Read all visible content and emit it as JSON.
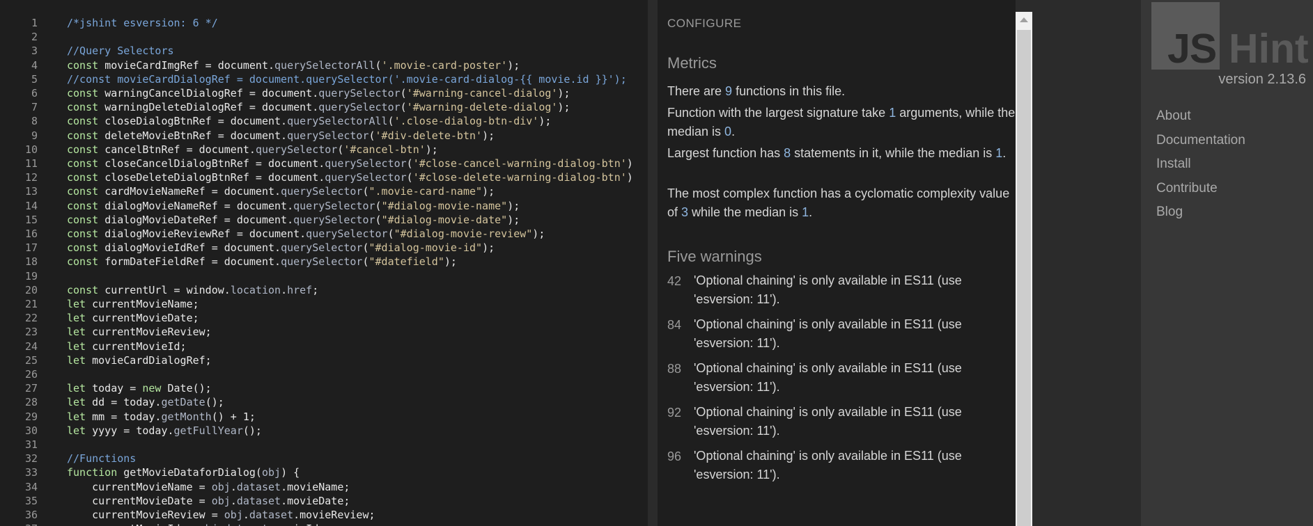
{
  "editor": {
    "lines": [
      {
        "n": "1",
        "t": [
          {
            "c": "cm",
            "s": "/*jshint esversion: 6 */"
          }
        ]
      },
      {
        "n": "2",
        "t": []
      },
      {
        "n": "3",
        "t": [
          {
            "c": "cm",
            "s": "//Query Selectors"
          }
        ]
      },
      {
        "n": "4",
        "t": [
          {
            "c": "kw",
            "s": "const "
          },
          {
            "c": "tx",
            "s": "movieCardImgRef = document."
          },
          {
            "c": "fn",
            "s": "querySelectorAll"
          },
          {
            "c": "tx",
            "s": "("
          },
          {
            "c": "st",
            "s": "'.movie-card-poster'"
          },
          {
            "c": "tx",
            "s": ");"
          }
        ]
      },
      {
        "n": "5",
        "t": [
          {
            "c": "cm",
            "s": "//const movieCardDialogRef = document.querySelector('.movie-card-dialog-{{ movie.id }}');"
          }
        ]
      },
      {
        "n": "6",
        "t": [
          {
            "c": "kw",
            "s": "const "
          },
          {
            "c": "tx",
            "s": "warningCancelDialogRef = document."
          },
          {
            "c": "fn",
            "s": "querySelector"
          },
          {
            "c": "tx",
            "s": "("
          },
          {
            "c": "st",
            "s": "'#warning-cancel-dialog'"
          },
          {
            "c": "tx",
            "s": ");"
          }
        ]
      },
      {
        "n": "7",
        "t": [
          {
            "c": "kw",
            "s": "const "
          },
          {
            "c": "tx",
            "s": "warningDeleteDialogRef = document."
          },
          {
            "c": "fn",
            "s": "querySelector"
          },
          {
            "c": "tx",
            "s": "("
          },
          {
            "c": "st",
            "s": "'#warning-delete-dialog'"
          },
          {
            "c": "tx",
            "s": ");"
          }
        ]
      },
      {
        "n": "8",
        "t": [
          {
            "c": "kw",
            "s": "const "
          },
          {
            "c": "tx",
            "s": "closeDialogBtnRef = document."
          },
          {
            "c": "fn",
            "s": "querySelectorAll"
          },
          {
            "c": "tx",
            "s": "("
          },
          {
            "c": "st",
            "s": "'.close-dialog-btn-div'"
          },
          {
            "c": "tx",
            "s": ");"
          }
        ]
      },
      {
        "n": "9",
        "t": [
          {
            "c": "kw",
            "s": "const "
          },
          {
            "c": "tx",
            "s": "deleteMovieBtnRef = document."
          },
          {
            "c": "fn",
            "s": "querySelector"
          },
          {
            "c": "tx",
            "s": "("
          },
          {
            "c": "st",
            "s": "'#div-delete-btn'"
          },
          {
            "c": "tx",
            "s": ");"
          }
        ]
      },
      {
        "n": "10",
        "t": [
          {
            "c": "kw",
            "s": "const "
          },
          {
            "c": "tx",
            "s": "cancelBtnRef = document."
          },
          {
            "c": "fn",
            "s": "querySelector"
          },
          {
            "c": "tx",
            "s": "("
          },
          {
            "c": "st",
            "s": "'#cancel-btn'"
          },
          {
            "c": "tx",
            "s": ");"
          }
        ]
      },
      {
        "n": "11",
        "t": [
          {
            "c": "kw",
            "s": "const "
          },
          {
            "c": "tx",
            "s": "closeCancelDialogBtnRef = document."
          },
          {
            "c": "fn",
            "s": "querySelector"
          },
          {
            "c": "tx",
            "s": "("
          },
          {
            "c": "st",
            "s": "'#close-cancel-warning-dialog-btn'"
          },
          {
            "c": "tx",
            "s": ")"
          }
        ]
      },
      {
        "n": "12",
        "t": [
          {
            "c": "kw",
            "s": "const "
          },
          {
            "c": "tx",
            "s": "closeDeleteDialogBtnRef = document."
          },
          {
            "c": "fn",
            "s": "querySelector"
          },
          {
            "c": "tx",
            "s": "("
          },
          {
            "c": "st",
            "s": "'#close-delete-warning-dialog-btn'"
          },
          {
            "c": "tx",
            "s": ")"
          }
        ]
      },
      {
        "n": "13",
        "t": [
          {
            "c": "kw",
            "s": "const "
          },
          {
            "c": "tx",
            "s": "cardMovieNameRef = document."
          },
          {
            "c": "fn",
            "s": "querySelector"
          },
          {
            "c": "tx",
            "s": "("
          },
          {
            "c": "st",
            "s": "\".movie-card-name\""
          },
          {
            "c": "tx",
            "s": ");"
          }
        ]
      },
      {
        "n": "14",
        "t": [
          {
            "c": "kw",
            "s": "const "
          },
          {
            "c": "tx",
            "s": "dialogMovieNameRef = document."
          },
          {
            "c": "fn",
            "s": "querySelector"
          },
          {
            "c": "tx",
            "s": "("
          },
          {
            "c": "st",
            "s": "\"#dialog-movie-name\""
          },
          {
            "c": "tx",
            "s": ");"
          }
        ]
      },
      {
        "n": "15",
        "t": [
          {
            "c": "kw",
            "s": "const "
          },
          {
            "c": "tx",
            "s": "dialogMovieDateRef = document."
          },
          {
            "c": "fn",
            "s": "querySelector"
          },
          {
            "c": "tx",
            "s": "("
          },
          {
            "c": "st",
            "s": "\"#dialog-movie-date\""
          },
          {
            "c": "tx",
            "s": ");"
          }
        ]
      },
      {
        "n": "16",
        "t": [
          {
            "c": "kw",
            "s": "const "
          },
          {
            "c": "tx",
            "s": "dialogMovieReviewRef = document."
          },
          {
            "c": "fn",
            "s": "querySelector"
          },
          {
            "c": "tx",
            "s": "("
          },
          {
            "c": "st",
            "s": "\"#dialog-movie-review\""
          },
          {
            "c": "tx",
            "s": ");"
          }
        ]
      },
      {
        "n": "17",
        "t": [
          {
            "c": "kw",
            "s": "const "
          },
          {
            "c": "tx",
            "s": "dialogMovieIdRef = document."
          },
          {
            "c": "fn",
            "s": "querySelector"
          },
          {
            "c": "tx",
            "s": "("
          },
          {
            "c": "st",
            "s": "\"#dialog-movie-id\""
          },
          {
            "c": "tx",
            "s": ");"
          }
        ]
      },
      {
        "n": "18",
        "t": [
          {
            "c": "kw",
            "s": "const "
          },
          {
            "c": "tx",
            "s": "formDateFieldRef = document."
          },
          {
            "c": "fn",
            "s": "querySelector"
          },
          {
            "c": "tx",
            "s": "("
          },
          {
            "c": "st",
            "s": "\"#datefield\""
          },
          {
            "c": "tx",
            "s": ");"
          }
        ]
      },
      {
        "n": "19",
        "t": []
      },
      {
        "n": "20",
        "t": [
          {
            "c": "kw",
            "s": "const "
          },
          {
            "c": "tx",
            "s": "currentUrl = window."
          },
          {
            "c": "fn",
            "s": "location"
          },
          {
            "c": "tx",
            "s": "."
          },
          {
            "c": "fn",
            "s": "href"
          },
          {
            "c": "tx",
            "s": ";"
          }
        ]
      },
      {
        "n": "21",
        "t": [
          {
            "c": "kw",
            "s": "let "
          },
          {
            "c": "tx",
            "s": "currentMovieName;"
          }
        ]
      },
      {
        "n": "22",
        "t": [
          {
            "c": "kw",
            "s": "let "
          },
          {
            "c": "tx",
            "s": "currentMovieDate;"
          }
        ]
      },
      {
        "n": "23",
        "t": [
          {
            "c": "kw",
            "s": "let "
          },
          {
            "c": "tx",
            "s": "currentMovieReview;"
          }
        ]
      },
      {
        "n": "24",
        "t": [
          {
            "c": "kw",
            "s": "let "
          },
          {
            "c": "tx",
            "s": "currentMovieId;"
          }
        ]
      },
      {
        "n": "25",
        "t": [
          {
            "c": "kw",
            "s": "let "
          },
          {
            "c": "tx",
            "s": "movieCardDialogRef;"
          }
        ]
      },
      {
        "n": "26",
        "t": []
      },
      {
        "n": "27",
        "t": [
          {
            "c": "kw",
            "s": "let "
          },
          {
            "c": "tx",
            "s": "today = "
          },
          {
            "c": "kw",
            "s": "new "
          },
          {
            "c": "tx",
            "s": "Date();"
          }
        ]
      },
      {
        "n": "28",
        "t": [
          {
            "c": "kw",
            "s": "let "
          },
          {
            "c": "tx",
            "s": "dd = today."
          },
          {
            "c": "fn",
            "s": "getDate"
          },
          {
            "c": "tx",
            "s": "();"
          }
        ]
      },
      {
        "n": "29",
        "t": [
          {
            "c": "kw",
            "s": "let "
          },
          {
            "c": "tx",
            "s": "mm = today."
          },
          {
            "c": "fn",
            "s": "getMonth"
          },
          {
            "c": "tx",
            "s": "() + 1;"
          }
        ]
      },
      {
        "n": "30",
        "t": [
          {
            "c": "kw",
            "s": "let "
          },
          {
            "c": "tx",
            "s": "yyyy = today."
          },
          {
            "c": "fn",
            "s": "getFullYear"
          },
          {
            "c": "tx",
            "s": "();"
          }
        ]
      },
      {
        "n": "31",
        "t": []
      },
      {
        "n": "32",
        "t": [
          {
            "c": "cm",
            "s": "//Functions"
          }
        ]
      },
      {
        "n": "33",
        "t": [
          {
            "c": "kw",
            "s": "function "
          },
          {
            "c": "tx",
            "s": "getMovieDataforDialog("
          },
          {
            "c": "fn",
            "s": "obj"
          },
          {
            "c": "tx",
            "s": ") {"
          }
        ]
      },
      {
        "n": "34",
        "t": [
          {
            "c": "tx",
            "s": "    currentMovieName = "
          },
          {
            "c": "fn",
            "s": "obj"
          },
          {
            "c": "tx",
            "s": "."
          },
          {
            "c": "fn",
            "s": "dataset"
          },
          {
            "c": "tx",
            "s": ".movieName;"
          }
        ]
      },
      {
        "n": "35",
        "t": [
          {
            "c": "tx",
            "s": "    currentMovieDate = "
          },
          {
            "c": "fn",
            "s": "obj"
          },
          {
            "c": "tx",
            "s": "."
          },
          {
            "c": "fn",
            "s": "dataset"
          },
          {
            "c": "tx",
            "s": ".movieDate;"
          }
        ]
      },
      {
        "n": "36",
        "t": [
          {
            "c": "tx",
            "s": "    currentMovieReview = "
          },
          {
            "c": "fn",
            "s": "obj"
          },
          {
            "c": "tx",
            "s": "."
          },
          {
            "c": "fn",
            "s": "dataset"
          },
          {
            "c": "tx",
            "s": ".movieReview;"
          }
        ]
      },
      {
        "n": "37",
        "t": [
          {
            "c": "tx",
            "s": "    currentMovieId = "
          },
          {
            "c": "fn",
            "s": "obj"
          },
          {
            "c": "tx",
            "s": "."
          },
          {
            "c": "fn",
            "s": "dataset"
          },
          {
            "c": "tx",
            "s": ".movieId;"
          }
        ]
      }
    ]
  },
  "report": {
    "configure_label": "CONFIGURE",
    "metrics_title": "Metrics",
    "metric_functions": {
      "a": "There are ",
      "n": "9",
      "b": " functions in this file."
    },
    "metric_signature": {
      "a": "Function with the largest signature take ",
      "n": "1",
      "b": " arguments, while the median is ",
      "m": "0",
      "c": "."
    },
    "metric_statements": {
      "a": "Largest function has ",
      "n": "8",
      "b": " statements in it, while the median is ",
      "m": "1",
      "c": "."
    },
    "metric_complexity": {
      "a": "The most complex function has a cyclomatic complexity value of ",
      "n": "3",
      "b": " while the median is ",
      "m": "1",
      "c": "."
    },
    "warnings_title": "Five warnings",
    "warnings": [
      {
        "line": "42",
        "msg": "'Optional chaining' is only available in ES11 (use 'esversion: 11')."
      },
      {
        "line": "84",
        "msg": "'Optional chaining' is only available in ES11 (use 'esversion: 11')."
      },
      {
        "line": "88",
        "msg": "'Optional chaining' is only available in ES11 (use 'esversion: 11')."
      },
      {
        "line": "92",
        "msg": "'Optional chaining' is only available in ES11 (use 'esversion: 11')."
      },
      {
        "line": "96",
        "msg": "'Optional chaining' is only available in ES11 (use 'esversion: 11')."
      }
    ]
  },
  "sidebar": {
    "logo_js": "JS",
    "logo_hint": "Hint",
    "version": "version 2.13.6",
    "nav": [
      {
        "label": "About"
      },
      {
        "label": "Documentation"
      },
      {
        "label": "Install"
      },
      {
        "label": "Contribute"
      },
      {
        "label": "Blog"
      }
    ]
  },
  "colors": {
    "editor_bg": "#1e1e1e",
    "sidebar_bg": "#373737",
    "keyword": "#b5e7a0",
    "comment": "#7aa6da",
    "string": "#d4c49c",
    "highlight": "#8fb6e0"
  }
}
